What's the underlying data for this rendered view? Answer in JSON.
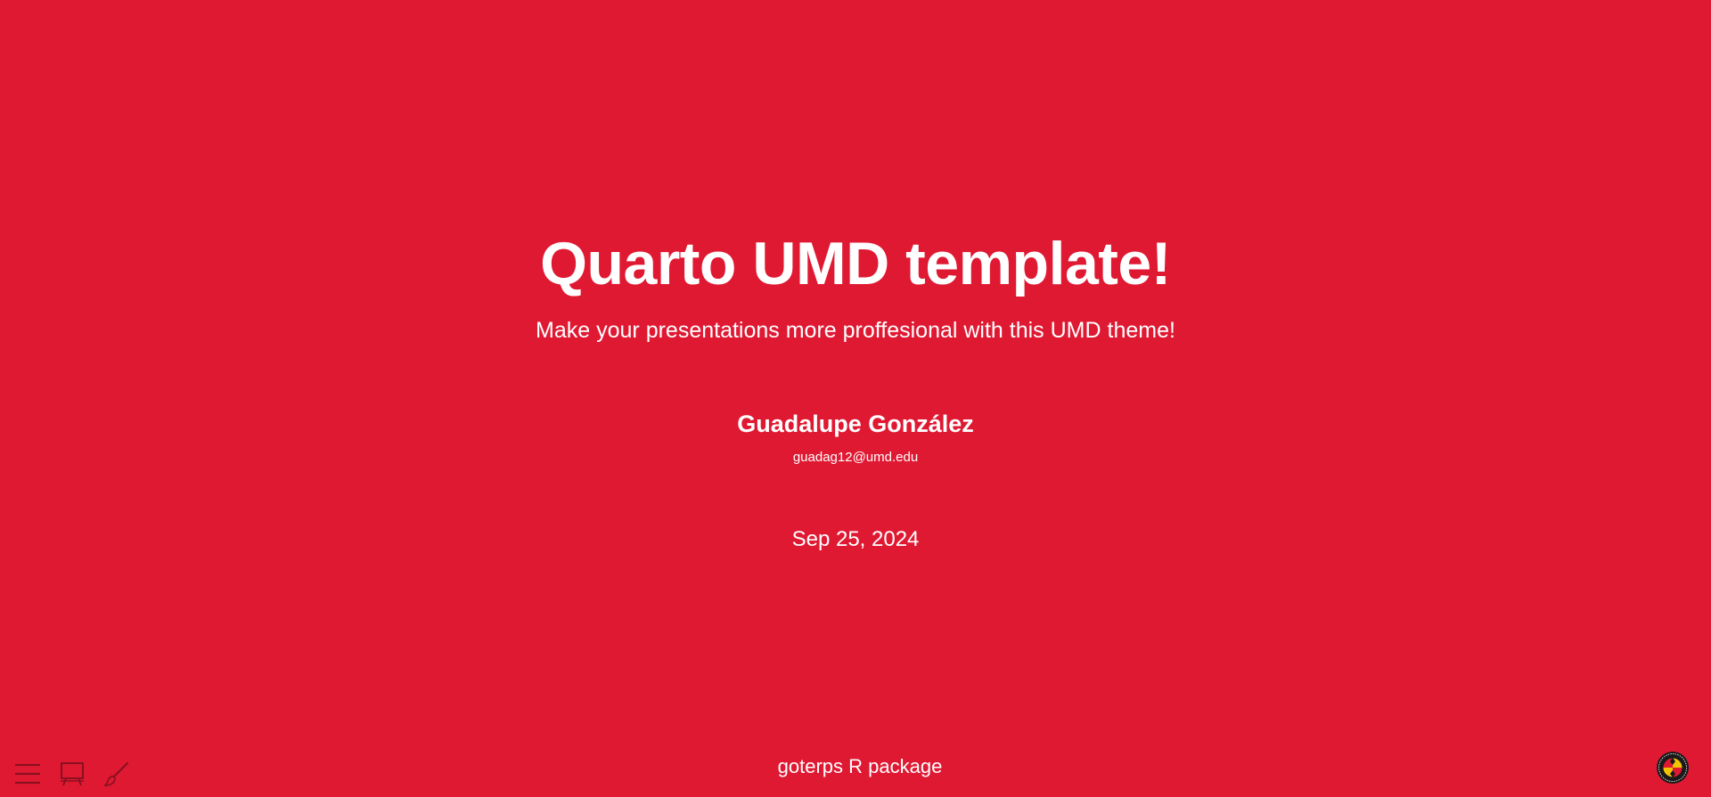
{
  "slide": {
    "title": "Quarto UMD template!",
    "subtitle": "Make your presentations more proffesional with this UMD theme!",
    "author": "Guadalupe González",
    "email": "guadag12@umd.edu",
    "date": "Sep 25, 2024",
    "footer": "goterps R package"
  },
  "controls": {
    "menu_icon": "hamburger-menu-icon",
    "slide_overview_icon": "easel-icon",
    "chalkboard_icon": "brush-icon"
  },
  "logo": {
    "icon": "umd-seal-logo"
  },
  "colors": {
    "background": "#e01933",
    "text": "#ffffff",
    "control_stroke": "#8a1020"
  }
}
